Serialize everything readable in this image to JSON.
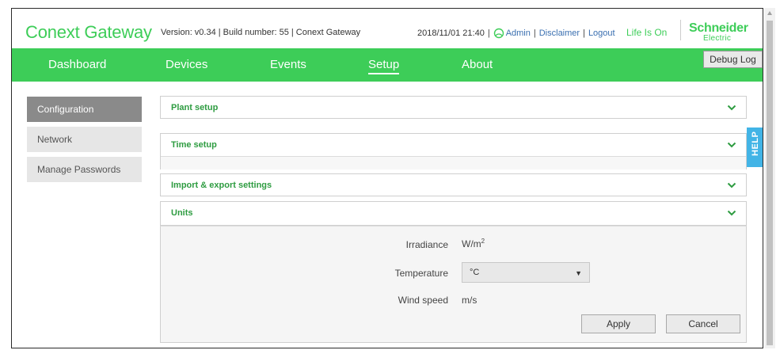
{
  "header": {
    "app_title": "Conext Gateway",
    "version_info": "Version: v0.34 | Build number: 55 | Conext Gateway",
    "datetime": "2018/11/01 21:40",
    "user": "Admin",
    "disclaimer": "Disclaimer",
    "logout": "Logout",
    "tagline": "Life Is On",
    "brand_name": "Schneider",
    "brand_sub": "Electric"
  },
  "nav": {
    "items": [
      {
        "label": "Dashboard"
      },
      {
        "label": "Devices"
      },
      {
        "label": "Events"
      },
      {
        "label": "Setup",
        "active": true
      },
      {
        "label": "About"
      }
    ],
    "debug_log": "Debug Log"
  },
  "sidebar": {
    "items": [
      {
        "label": "Configuration",
        "active": true
      },
      {
        "label": "Network"
      },
      {
        "label": "Manage Passwords"
      }
    ]
  },
  "panels": [
    {
      "title": "Plant setup"
    },
    {
      "title": "Time setup"
    },
    {
      "title": "Import & export settings"
    },
    {
      "title": "Units"
    }
  ],
  "units": {
    "irradiance_label": "Irradiance",
    "irradiance_value": "W/m",
    "irradiance_sup": "2",
    "temperature_label": "Temperature",
    "temperature_value": "°C",
    "wind_label": "Wind speed",
    "wind_value": "m/s",
    "apply": "Apply",
    "cancel": "Cancel"
  },
  "help": "HELP",
  "colors": {
    "brand_green": "#3dcd58",
    "accent_green_text": "#2e9c41",
    "help_blue": "#42b4e6",
    "link_blue": "#3a6fb0"
  },
  "icons": [
    "user-icon",
    "chevron-down-icon",
    "caret-down-icon",
    "scroll-up-icon"
  ]
}
